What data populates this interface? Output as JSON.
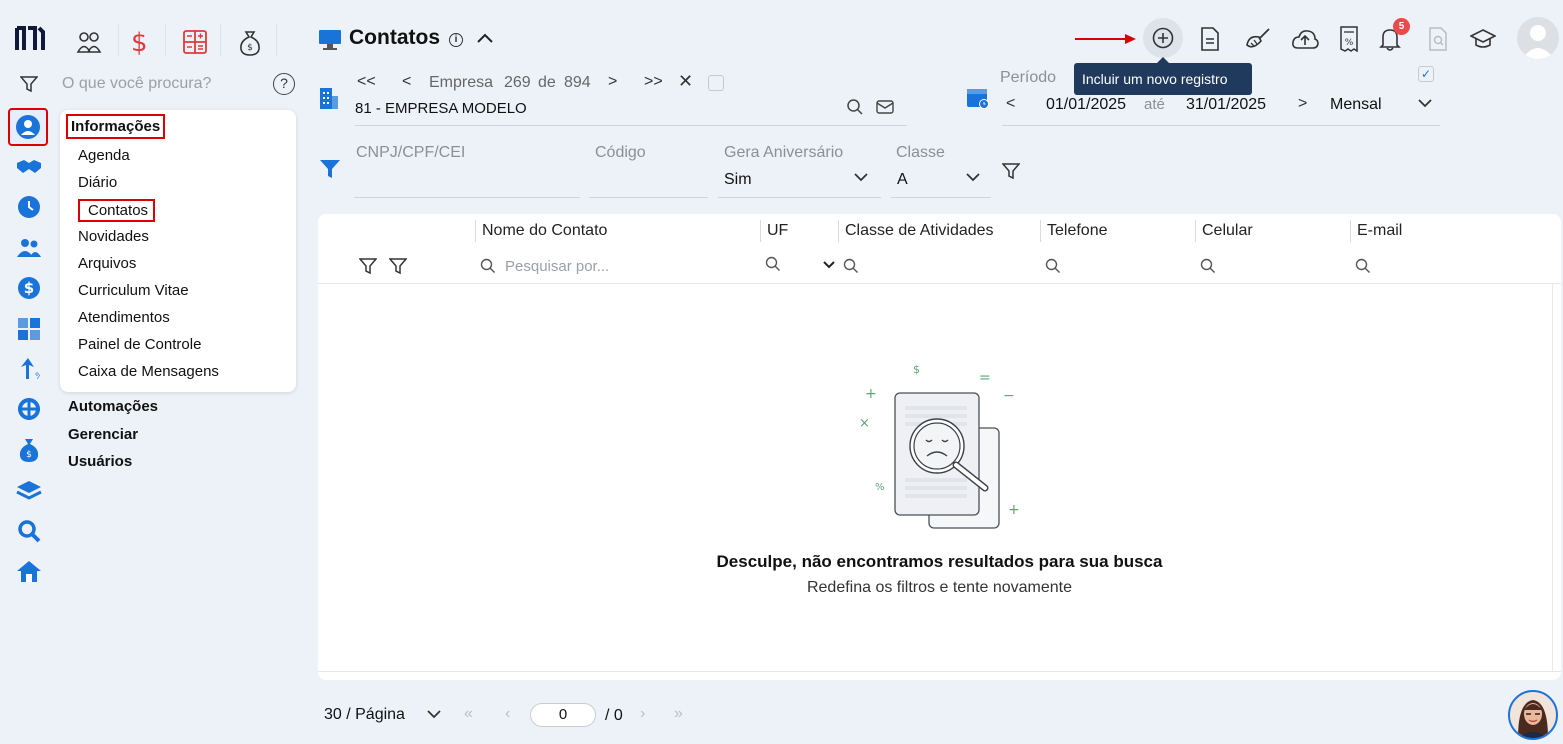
{
  "header": {
    "title": "Contatos",
    "search_placeholder": "O que você procura?",
    "tooltip_add": "Incluir um novo registro",
    "notification_count": "5"
  },
  "menu": {
    "section_title": "Informações",
    "items": [
      "Agenda",
      "Diário",
      "Contatos",
      "Novidades",
      "Arquivos",
      "Curriculum Vitae",
      "Atendimentos",
      "Painel de Controle",
      "Caixa de Mensagens"
    ],
    "sections": [
      "Automações",
      "Gerenciar",
      "Usuários"
    ]
  },
  "company": {
    "nav_label": "Empresa",
    "index": "269",
    "of": "de",
    "total": "894",
    "name": "81 - EMPRESA MODELO"
  },
  "period": {
    "label": "Período",
    "from": "01/01/2025",
    "until": "até",
    "to": "31/01/2025",
    "mode": "Mensal"
  },
  "filters": {
    "cnpj_label": "CNPJ/CPF/CEI",
    "code_label": "Código",
    "birthday_label": "Gera Aniversário",
    "birthday_value": "Sim",
    "class_label": "Classe",
    "class_value": "A"
  },
  "table": {
    "columns": [
      "Nome do Contato",
      "UF",
      "Classe de Atividades",
      "Telefone",
      "Celular",
      "E-mail"
    ],
    "search_placeholder": "Pesquisar por..."
  },
  "empty": {
    "title": "Desculpe, não encontramos resultados para sua busca",
    "subtitle": "Redefina os filtros e tente novamente"
  },
  "pagination": {
    "per_page": "30 / Página",
    "current": "0",
    "total": "/ 0"
  },
  "colors": {
    "accent": "#1a73d9",
    "red": "#e03a3a",
    "tooltip_bg": "#1f3a5c"
  }
}
